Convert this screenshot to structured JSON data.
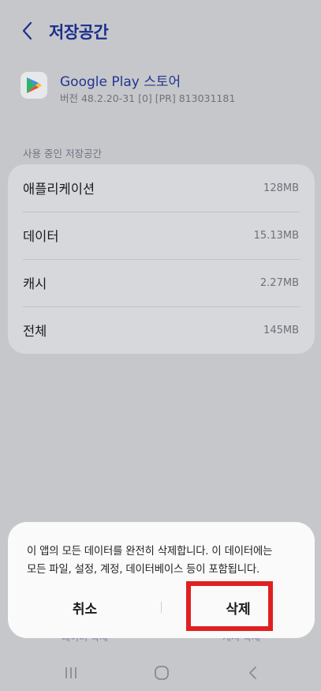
{
  "header": {
    "title": "저장공간"
  },
  "app": {
    "name": "Google Play 스토어",
    "version": "버전 48.2.20-31 [0] [PR] 813031181"
  },
  "storage": {
    "section_label": "사용 중인 저장공간",
    "rows": [
      {
        "label": "애플리케이션",
        "value": "128MB"
      },
      {
        "label": "데이터",
        "value": "15.13MB"
      },
      {
        "label": "캐시",
        "value": "2.27MB"
      },
      {
        "label": "전체",
        "value": "145MB"
      }
    ]
  },
  "background_actions": {
    "clear_data": "데이터 삭제",
    "clear_cache": "캐시 삭제"
  },
  "dialog": {
    "message_line1": "이 앱의 모든 데이터를 완전히 삭제합니다. 이 데이터에는",
    "message_line2": "모든 파일, 설정, 계정, 데이터베이스 등이 포함됩니다.",
    "cancel_label": "취소",
    "delete_label": "삭제"
  },
  "colors": {
    "accent": "#1d2f8c",
    "highlight": "#e02020",
    "dialog_bg": "#fafafa"
  },
  "icons": {
    "back": "chevron-left-icon",
    "app": "google-play-icon",
    "recents": "recents-icon",
    "home": "home-icon",
    "nav_back": "back-icon"
  }
}
